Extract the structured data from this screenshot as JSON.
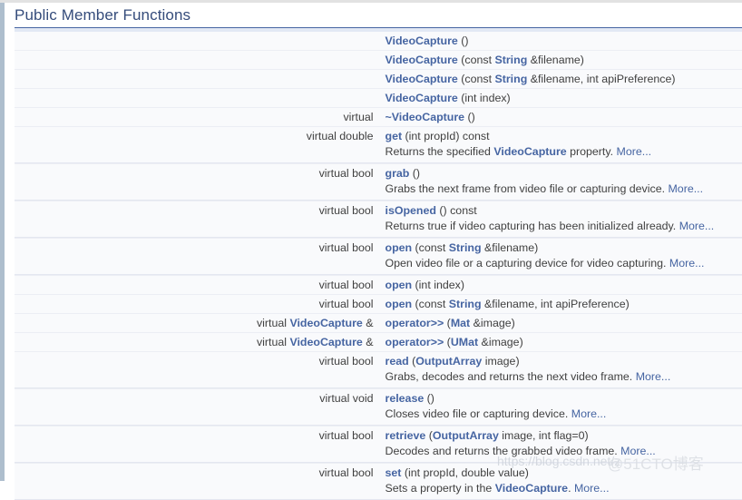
{
  "section": {
    "title": "Public Member Functions"
  },
  "watermarks": {
    "csdn": "https://blog.csdn.net/z",
    "cto": "@51CTO博客"
  },
  "more_label": "More...",
  "rows": [
    {
      "left": [],
      "right": [
        {
          "t": "VideoCapture",
          "link": true
        },
        {
          "t": " ()",
          "link": false
        }
      ],
      "desc": null
    },
    {
      "left": [],
      "right": [
        {
          "t": "VideoCapture",
          "link": true
        },
        {
          "t": " (const ",
          "link": false
        },
        {
          "t": "String",
          "link": true
        },
        {
          "t": " &filename)",
          "link": false
        }
      ],
      "desc": null
    },
    {
      "left": [],
      "right": [
        {
          "t": "VideoCapture",
          "link": true
        },
        {
          "t": " (const ",
          "link": false
        },
        {
          "t": "String",
          "link": true
        },
        {
          "t": " &filename, int apiPreference)",
          "link": false
        }
      ],
      "desc": null
    },
    {
      "left": [],
      "right": [
        {
          "t": "VideoCapture",
          "link": true
        },
        {
          "t": " (int index)",
          "link": false
        }
      ],
      "desc": null
    },
    {
      "left": [
        {
          "t": "virtual",
          "link": false
        }
      ],
      "right": [
        {
          "t": "~VideoCapture",
          "link": true
        },
        {
          "t": " ()",
          "link": false
        }
      ],
      "desc": null
    },
    {
      "left": [
        {
          "t": "virtual double",
          "link": false
        }
      ],
      "right": [
        {
          "t": "get",
          "link": true
        },
        {
          "t": " (int propId) const",
          "link": false
        }
      ],
      "desc": [
        {
          "t": "Returns the specified ",
          "link": false
        },
        {
          "t": "VideoCapture",
          "link": true
        },
        {
          "t": " property. ",
          "link": false
        },
        {
          "t": "More...",
          "more": true
        }
      ]
    },
    {
      "left": [
        {
          "t": "virtual bool",
          "link": false
        }
      ],
      "right": [
        {
          "t": "grab",
          "link": true
        },
        {
          "t": " ()",
          "link": false
        }
      ],
      "desc": [
        {
          "t": "Grabs the next frame from video file or capturing device. ",
          "link": false
        },
        {
          "t": "More...",
          "more": true
        }
      ]
    },
    {
      "left": [
        {
          "t": "virtual bool",
          "link": false
        }
      ],
      "right": [
        {
          "t": "isOpened",
          "link": true
        },
        {
          "t": " () const",
          "link": false
        }
      ],
      "desc": [
        {
          "t": "Returns true if video capturing has been initialized already. ",
          "link": false
        },
        {
          "t": "More...",
          "more": true
        }
      ]
    },
    {
      "left": [
        {
          "t": "virtual bool",
          "link": false
        }
      ],
      "right": [
        {
          "t": "open",
          "link": true
        },
        {
          "t": " (const ",
          "link": false
        },
        {
          "t": "String",
          "link": true
        },
        {
          "t": " &filename)",
          "link": false
        }
      ],
      "desc": [
        {
          "t": "Open video file or a capturing device for video capturing. ",
          "link": false
        },
        {
          "t": "More...",
          "more": true
        }
      ]
    },
    {
      "left": [
        {
          "t": "virtual bool",
          "link": false
        }
      ],
      "right": [
        {
          "t": "open",
          "link": true
        },
        {
          "t": " (int index)",
          "link": false
        }
      ],
      "desc": null
    },
    {
      "left": [
        {
          "t": "virtual bool",
          "link": false
        }
      ],
      "right": [
        {
          "t": "open",
          "link": true
        },
        {
          "t": " (const ",
          "link": false
        },
        {
          "t": "String",
          "link": true
        },
        {
          "t": " &filename, int apiPreference)",
          "link": false
        }
      ],
      "desc": null
    },
    {
      "left": [
        {
          "t": "virtual ",
          "link": false
        },
        {
          "t": "VideoCapture",
          "link": true
        },
        {
          "t": " &",
          "link": false
        }
      ],
      "right": [
        {
          "t": "operator>>",
          "link": true
        },
        {
          "t": " (",
          "link": false
        },
        {
          "t": "Mat",
          "link": true
        },
        {
          "t": " &image)",
          "link": false
        }
      ],
      "desc": null
    },
    {
      "left": [
        {
          "t": "virtual ",
          "link": false
        },
        {
          "t": "VideoCapture",
          "link": true
        },
        {
          "t": " &",
          "link": false
        }
      ],
      "right": [
        {
          "t": "operator>>",
          "link": true
        },
        {
          "t": " (",
          "link": false
        },
        {
          "t": "UMat",
          "link": true
        },
        {
          "t": " &image)",
          "link": false
        }
      ],
      "desc": null
    },
    {
      "left": [
        {
          "t": "virtual bool",
          "link": false
        }
      ],
      "right": [
        {
          "t": "read",
          "link": true
        },
        {
          "t": " (",
          "link": false
        },
        {
          "t": "OutputArray",
          "link": true
        },
        {
          "t": " image)",
          "link": false
        }
      ],
      "desc": [
        {
          "t": "Grabs, decodes and returns the next video frame. ",
          "link": false
        },
        {
          "t": "More...",
          "more": true
        }
      ]
    },
    {
      "left": [
        {
          "t": "virtual void",
          "link": false
        }
      ],
      "right": [
        {
          "t": "release",
          "link": true
        },
        {
          "t": " ()",
          "link": false
        }
      ],
      "desc": [
        {
          "t": "Closes video file or capturing device. ",
          "link": false
        },
        {
          "t": "More...",
          "more": true
        }
      ]
    },
    {
      "left": [
        {
          "t": "virtual bool",
          "link": false
        }
      ],
      "right": [
        {
          "t": "retrieve",
          "link": true
        },
        {
          "t": " (",
          "link": false
        },
        {
          "t": "OutputArray",
          "link": true
        },
        {
          "t": " image, int flag=0)",
          "link": false
        }
      ],
      "desc": [
        {
          "t": "Decodes and returns the grabbed video frame. ",
          "link": false
        },
        {
          "t": "More...",
          "more": true
        }
      ]
    },
    {
      "left": [
        {
          "t": "virtual bool",
          "link": false
        }
      ],
      "right": [
        {
          "t": "set",
          "link": true
        },
        {
          "t": " (int propId, double value)",
          "link": false
        }
      ],
      "desc": [
        {
          "t": "Sets a property in the ",
          "link": false
        },
        {
          "t": "VideoCapture",
          "link": true
        },
        {
          "t": ". ",
          "link": false
        },
        {
          "t": "More...",
          "more": true
        }
      ]
    }
  ]
}
